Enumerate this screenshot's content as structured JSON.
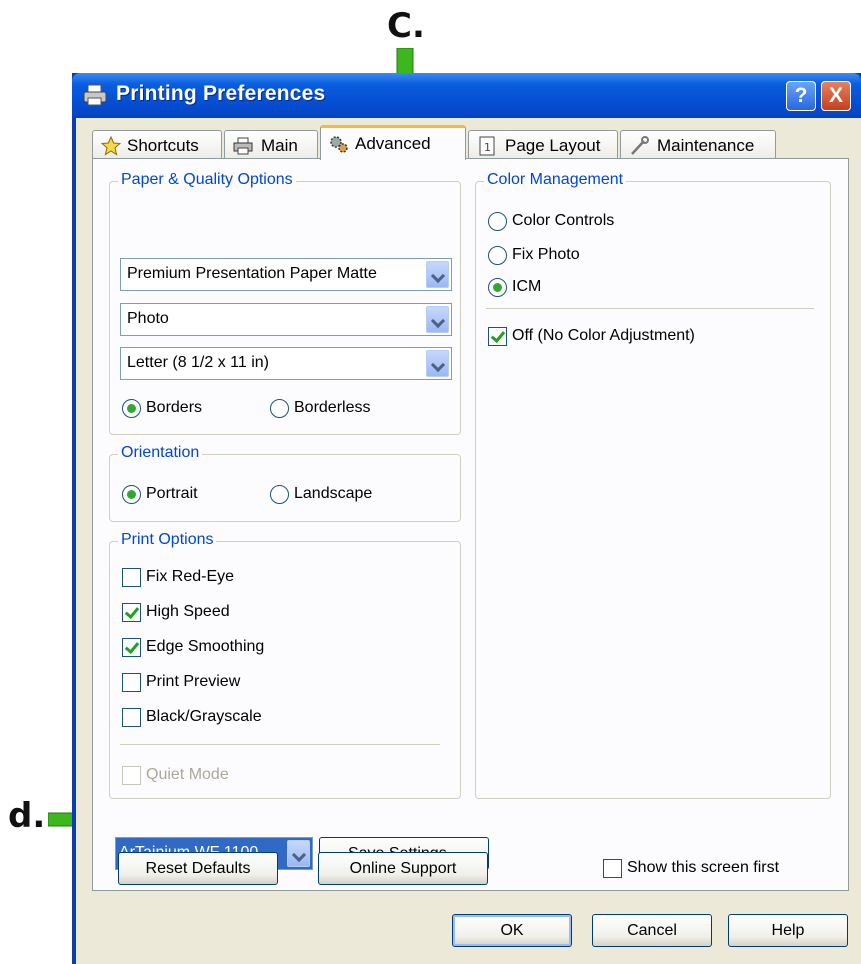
{
  "annotations": {
    "c_label": "C.",
    "d_label": "d."
  },
  "colors": {
    "arrow": "#3cb81c",
    "group_title": "#0046d5",
    "title_bar": "#0650d6"
  },
  "window": {
    "title": "Printing Preferences",
    "help_button": "?",
    "close_button": "X",
    "icon": "printer-icon"
  },
  "tabs": [
    {
      "label": "Shortcuts",
      "icon": "star-icon",
      "active": false
    },
    {
      "label": "Main",
      "icon": "printer-icon",
      "active": false
    },
    {
      "label": "Advanced",
      "icon": "gears-icon",
      "active": true
    },
    {
      "label": "Page Layout",
      "icon": "page-icon",
      "active": false
    },
    {
      "label": "Maintenance",
      "icon": "wrench-icon",
      "active": false
    }
  ],
  "paper_quality": {
    "title": "Paper & Quality Options",
    "paper_type": "Premium Presentation Paper Matte",
    "quality": "Photo",
    "paper_size": "Letter (8 1/2 x 11 in)",
    "borders_label": "Borders",
    "borderless_label": "Borderless",
    "selected": "Borders"
  },
  "orientation": {
    "title": "Orientation",
    "portrait_label": "Portrait",
    "landscape_label": "Landscape",
    "selected": "Portrait"
  },
  "print_options": {
    "title": "Print Options",
    "items": [
      {
        "label": "Fix Red-Eye",
        "checked": false
      },
      {
        "label": "High Speed",
        "checked": true
      },
      {
        "label": "Edge Smoothing",
        "checked": true
      },
      {
        "label": "Print Preview",
        "checked": false
      },
      {
        "label": "Black/Grayscale",
        "checked": false
      }
    ],
    "quiet_mode": {
      "label": "Quiet Mode",
      "checked": false,
      "enabled": false
    }
  },
  "color_management": {
    "title": "Color Management",
    "options": [
      "Color Controls",
      "Fix Photo",
      "ICM"
    ],
    "selected": "ICM",
    "off_label": "Off (No Color Adjustment)",
    "off_checked": true
  },
  "bottom": {
    "printer_select": "ArTainium WF 1100",
    "save_settings": "Save Settings...",
    "reset_defaults": "Reset Defaults",
    "online_support": "Online Support",
    "show_first_label": "Show this screen first",
    "show_first_checked": false
  },
  "footer": {
    "ok": "OK",
    "cancel": "Cancel",
    "help": "Help"
  }
}
